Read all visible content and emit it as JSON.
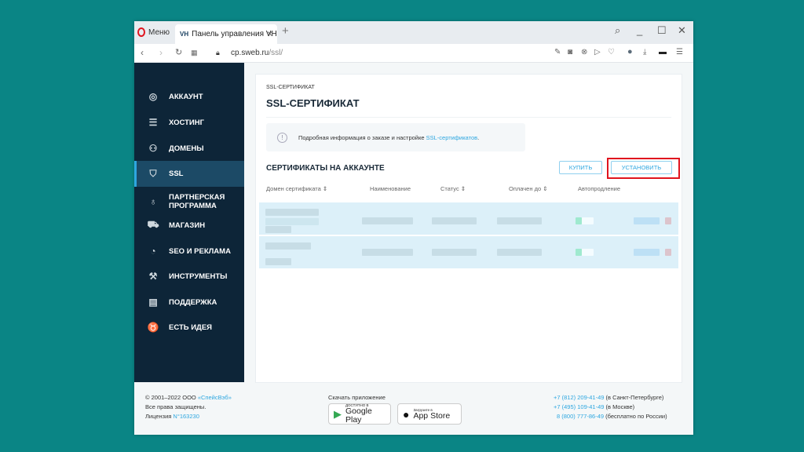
{
  "browser": {
    "menu_label": "Меню",
    "tab_title": "Панель управления VH",
    "tab_favicon": "VH",
    "url_host": "cp.sweb.ru",
    "url_path": "/ssl/",
    "new_tab_icon": "+",
    "close_tab_icon": "×"
  },
  "sidebar": {
    "items": [
      {
        "label": "АККАУНТ",
        "icon": "user-circle"
      },
      {
        "label": "ХОСТИНГ",
        "icon": "server"
      },
      {
        "label": "ДОМЕНЫ",
        "icon": "sitemap"
      },
      {
        "label": "SSL",
        "icon": "shield-check",
        "active": true
      },
      {
        "label": "ПАРТНЕРСКАЯ ПРОГРАММА",
        "icon": "money-bag"
      },
      {
        "label": "МАГАЗИН",
        "icon": "cart"
      },
      {
        "label": "SEO И РЕКЛАМА",
        "icon": "seo-chart"
      },
      {
        "label": "ИНСТРУМЕНТЫ",
        "icon": "wrench"
      },
      {
        "label": "ПОДДЕРЖКА",
        "icon": "chat"
      },
      {
        "label": "ЕСТЬ ИДЕЯ",
        "icon": "lightbulb"
      }
    ]
  },
  "main": {
    "breadcrumb": "SSL-СЕРТИФИКАТ",
    "title": "SSL-СЕРТИФИКАТ",
    "info_text": "Подробная информация о заказе и настройке ",
    "info_link": "SSL-сертификатов",
    "info_suffix": ".",
    "section_title": "СЕРТИФИКАТЫ НА АККАУНТЕ",
    "buy_button": "КУПИТЬ",
    "install_button": "УСТАНОВИТЬ",
    "columns": [
      "Домен сертификата ⇕",
      "Наименование",
      "Статус ⇕",
      "Оплачен до ⇕",
      "Автопродление"
    ],
    "rows_note": "2 rows with obscured (pixelated) content"
  },
  "footer": {
    "copyright": "© 2001–2022 ООО ",
    "company_link": "«СпейсВэб»",
    "rights": "Все права защищены.",
    "license_label": "Лицензия ",
    "license_link": "N°163230",
    "download_label": "Скачать приложение",
    "google_small": "ДОСТУПНО В",
    "google_big": "Google Play",
    "apple_small": "Загрузите в",
    "apple_big": "App Store",
    "phones": [
      {
        "number": "+7 (812) 209-41-49",
        "note": " (в Санкт-Петербурге)"
      },
      {
        "number": "+7 (495) 109-41-49",
        "note": " (в Москве)"
      },
      {
        "number": "8 (800) 777-86-49",
        "note": " (бесплатно по России)"
      }
    ]
  }
}
